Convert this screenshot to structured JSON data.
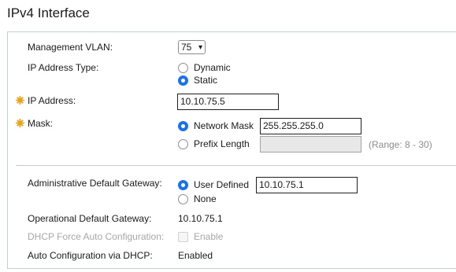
{
  "page": {
    "title": "IPv4 Interface"
  },
  "form": {
    "management_vlan": {
      "label": "Management VLAN:",
      "value": "75"
    },
    "ip_address_type": {
      "label": "IP Address Type:",
      "options": [
        "Dynamic",
        "Static"
      ],
      "selected": "Static"
    },
    "ip_address": {
      "label": "IP Address:",
      "value": "10.10.75.5",
      "required": true
    },
    "mask": {
      "label": "Mask:",
      "required": true,
      "network_mask": {
        "label": "Network Mask",
        "value": "255.255.255.0",
        "selected": true
      },
      "prefix_length": {
        "label": "Prefix Length",
        "value": "",
        "selected": false,
        "range": "(Range: 8 - 30)"
      }
    },
    "admin_default_gateway": {
      "label": "Administrative Default Gateway:",
      "user_defined": {
        "label": "User Defined",
        "value": "10.10.75.1",
        "selected": true
      },
      "none": {
        "label": "None",
        "selected": false
      }
    },
    "operational_default_gateway": {
      "label": "Operational Default Gateway:",
      "value": "10.10.75.1"
    },
    "dhcp_force_auto_config": {
      "label": "DHCP Force Auto Configuration:",
      "checkbox_label": "Enable",
      "checked": false,
      "disabled": true
    },
    "auto_config_via_dhcp": {
      "label": "Auto Configuration via DHCP:",
      "value": "Enabled"
    }
  },
  "colors": {
    "accent": "#1a73e8",
    "required_marker": "#e8a216",
    "panel_border": "#c5cdd6",
    "disabled_text": "#a7a7a7"
  },
  "icons": {
    "required": "required-asterisk-icon",
    "dropdown": "chevron-down-icon"
  }
}
